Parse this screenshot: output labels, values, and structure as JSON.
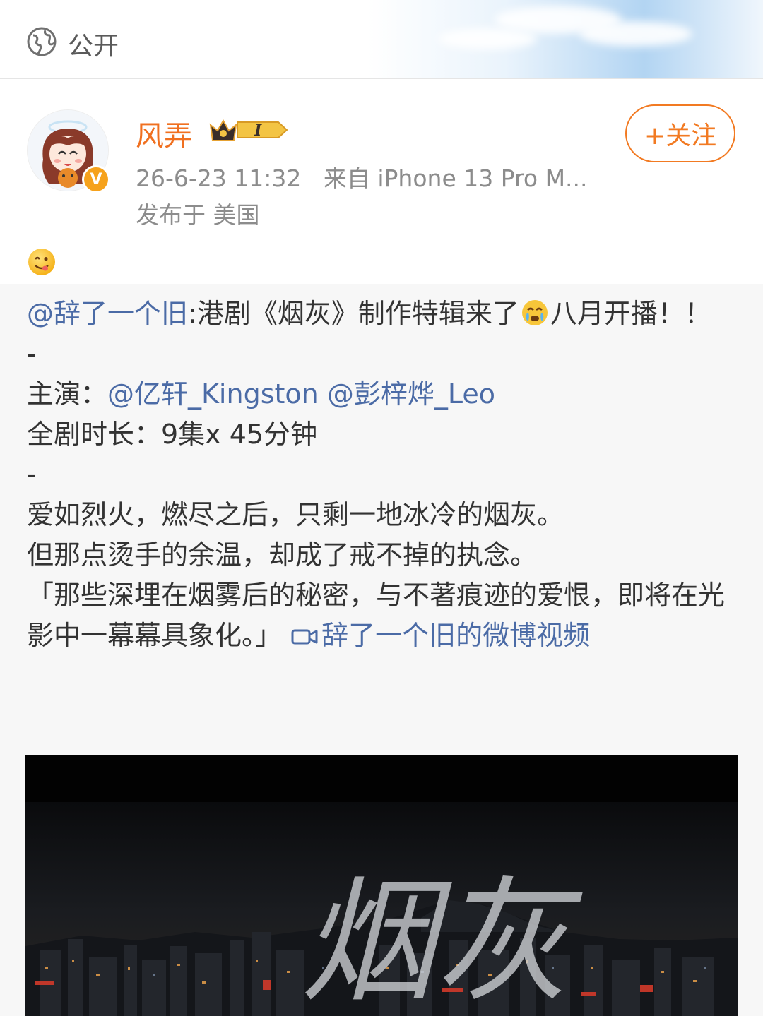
{
  "visibility": {
    "icon": "globe-icon",
    "label": "公开"
  },
  "post": {
    "username": "风弄",
    "vip_level": "I",
    "time": "26-6-23 11:32",
    "source": "来自 iPhone 13 Pro M...",
    "location": "发布于 美国",
    "follow_label": "+关注",
    "emoji": "smiley-tongue-emoji"
  },
  "repost": {
    "author_mention": "@辞了一个旧",
    "line1_text": ":港剧《烟灰》制作特辑来了",
    "line1_emoji": "crying-emoji",
    "line1_tail": "八月开播！！",
    "sep1": "-",
    "cast_label": "主演：",
    "cast_mention_1": "@亿轩_Kingston",
    "cast_mention_2": "@彭梓烨_Leo",
    "duration": "全剧时长：9集x 45分钟",
    "sep2": "-",
    "line_a": "爱如烈火，燃尽之后，只剩一地冰冷的烟灰。",
    "line_b": "但那点烫手的余温，却成了戒不掉的执念。",
    "line_c": "「那些深埋在烟雾后的秘密，与不著痕迹的爱恨，即将在光影中一幕幕具象化。」",
    "video_link": "辞了一个旧的微博视频"
  },
  "video": {
    "title_glyph": "烟灰",
    "description": "night-city-skyline-thumbnail"
  },
  "colors": {
    "username": "#f07020",
    "link": "#4b6ba6",
    "follow": "#f27a22",
    "meta": "#8c8c8c",
    "repost_bg": "#f7f7f7"
  }
}
